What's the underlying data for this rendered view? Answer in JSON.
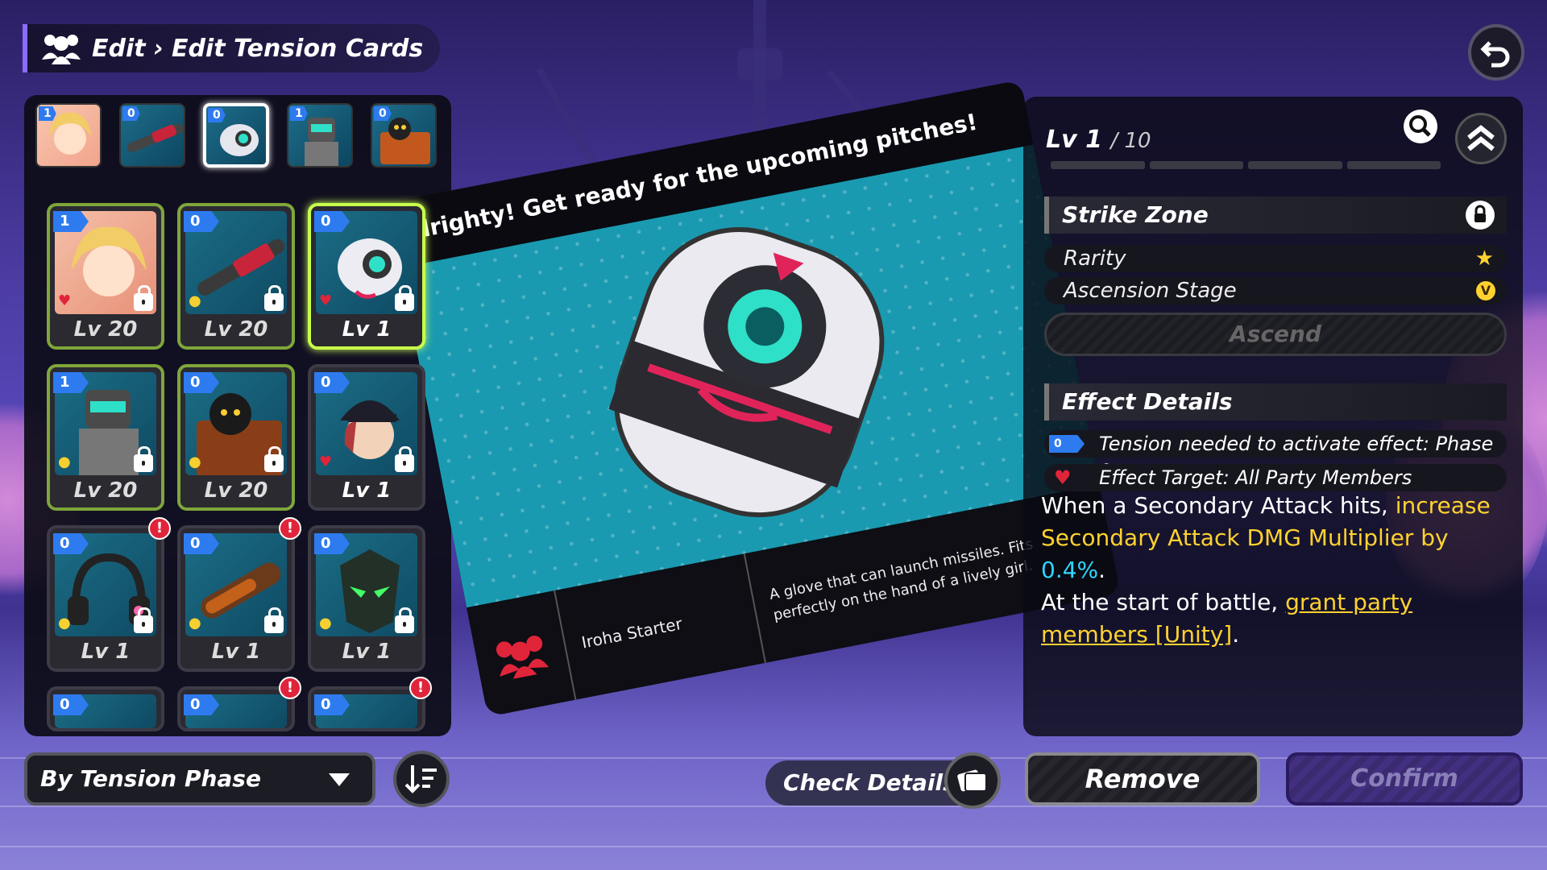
{
  "breadcrumb": {
    "edit": "Edit",
    "separator": "›",
    "current": "Edit Tension Cards"
  },
  "party": [
    {
      "badge": "1",
      "name": "idol-girl"
    },
    {
      "badge": "0",
      "name": "bat"
    },
    {
      "badge": "0",
      "name": "missile-glove"
    },
    {
      "badge": "1",
      "name": "catcher-robot"
    },
    {
      "badge": "0",
      "name": "cat-toolbox"
    }
  ],
  "cards": [
    {
      "badge": "1",
      "level": "Lv 20"
    },
    {
      "badge": "0",
      "level": "Lv 20"
    },
    {
      "badge": "0",
      "level": "Lv 1"
    },
    {
      "badge": "1",
      "level": "Lv 20"
    },
    {
      "badge": "0",
      "level": "Lv 20"
    },
    {
      "badge": "0",
      "level": "Lv 1"
    },
    {
      "badge": "0",
      "level": "Lv 1"
    },
    {
      "badge": "0",
      "level": "Lv 1"
    },
    {
      "badge": "0",
      "level": "Lv 1"
    },
    {
      "badge": "0",
      "level": ""
    },
    {
      "badge": "0",
      "level": ""
    },
    {
      "badge": "0",
      "level": ""
    }
  ],
  "alert_mark": "!",
  "showcase": {
    "quote": "Alrighty! Get ready for the upcoming pitches!",
    "name": "Iroha Starter",
    "description": "A glove that can launch missiles. Fits perfectly on the hand of a lively girl."
  },
  "detail": {
    "level_prefix": "Lv",
    "level_current": "1",
    "level_max": "/ 10",
    "card_name": "Strike Zone",
    "rarity_label": "Rarity",
    "ascension_label": "Ascension Stage",
    "ascension_mark": "V",
    "ascend_label": "Ascend",
    "effect_header": "Effect Details",
    "tension_badge": "0",
    "tension_text": "Tension needed to activate effect: Phase 0",
    "target_text": "Effect Target:  All Party Members",
    "effect1_a": "When a Secondary Attack hits, ",
    "effect1_b": "increase Secondary Attack DMG Multiplier by ",
    "effect1_c": "0.4%",
    "effect1_d": ".",
    "effect2_a": "At the start of battle, ",
    "effect2_b": "grant party members [Unity]",
    "effect2_c": "."
  },
  "bottom": {
    "sort_label": "By Tension Phase",
    "check_details": "Check Details",
    "remove": "Remove",
    "confirm": "Confirm"
  },
  "colors": {
    "accent": "#ffd230",
    "badge_blue": "#2e7bf0",
    "highlight_cyan": "#2fd6ff",
    "alert_red": "#e0243a"
  }
}
